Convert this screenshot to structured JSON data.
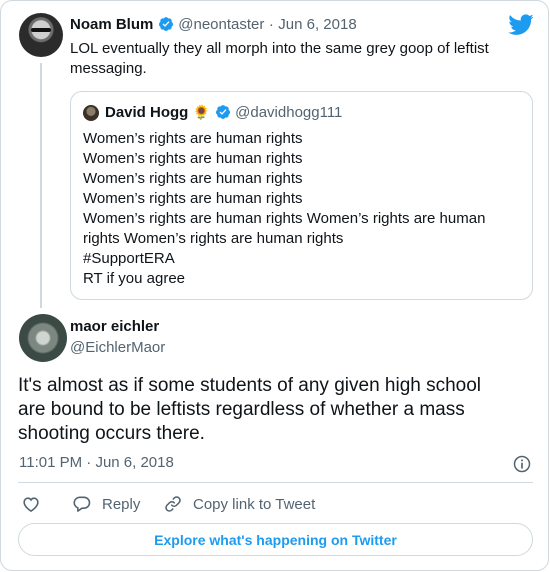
{
  "parent_tweet": {
    "author_name": "Noam Blum",
    "author_handle": "@neontaster",
    "separator": "·",
    "date": "Jun 6, 2018",
    "text_lines": [
      "LOL eventually they all morph into the same grey goop of leftist",
      "messaging."
    ]
  },
  "quoted_tweet": {
    "author_name": "David Hogg",
    "emoji": "🌻",
    "author_handle": "@davidhogg111",
    "lines": [
      "Women’s rights are human rights",
      "Women’s rights are human rights",
      "Women’s rights are human rights",
      "Women’s rights are human rights",
      "Women’s rights are human rights  Women’s rights are human",
      "rights Women’s rights are human rights",
      "#SupportERA",
      "RT if you agree"
    ]
  },
  "main_tweet": {
    "author_name": "maor eichler",
    "author_handle": "@EichlerMaor",
    "text_lines": [
      "It's almost as if some students of any given high school",
      "are bound to be leftists regardless of whether a mass",
      "shooting occurs there."
    ],
    "time": "11:01 PM",
    "separator": "·",
    "date": "Jun 6, 2018"
  },
  "actions": {
    "reply_label": "Reply",
    "copy_link_label": "Copy link to Tweet"
  },
  "explore_label": "Explore what's happening on Twitter",
  "colors": {
    "brand_blue": "#1d9bf0",
    "secondary_text": "#536471",
    "border": "#cfd9de"
  },
  "icons": [
    "twitter-bird-icon",
    "verified-badge-icon",
    "info-icon",
    "heart-icon",
    "reply-icon",
    "link-icon"
  ]
}
